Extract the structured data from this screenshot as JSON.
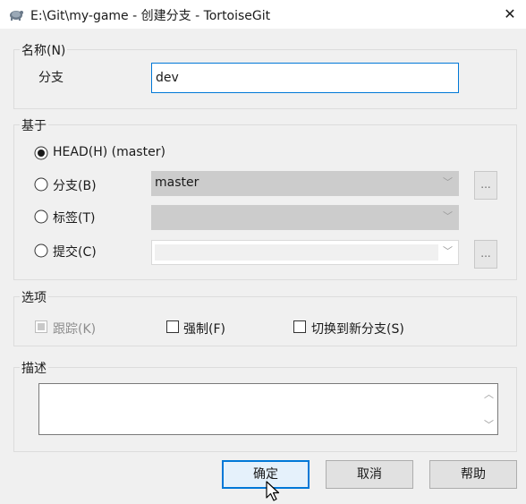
{
  "window": {
    "title": "E:\\Git\\my-game - 创建分支 - TortoiseGit",
    "close_glyph": "✕"
  },
  "name_group": {
    "legend": "名称(N)",
    "branch_label": "分支",
    "branch_value": "dev"
  },
  "base_group": {
    "legend": "基于",
    "head_label": "HEAD(H) (master)",
    "branch_label": "分支(B)",
    "branch_value": "master",
    "tag_label": "标签(T)",
    "commit_label": "提交(C)",
    "ellipsis": "..."
  },
  "options_group": {
    "legend": "选项",
    "track_label": "跟踪(K)",
    "force_label": "强制(F)",
    "switch_label": "切换到新分支(S)"
  },
  "desc_group": {
    "legend": "描述"
  },
  "buttons": {
    "ok": "确定",
    "cancel": "取消",
    "help": "帮助"
  },
  "colors": {
    "accent": "#0078d7",
    "disabled_fill": "#cccccc"
  }
}
